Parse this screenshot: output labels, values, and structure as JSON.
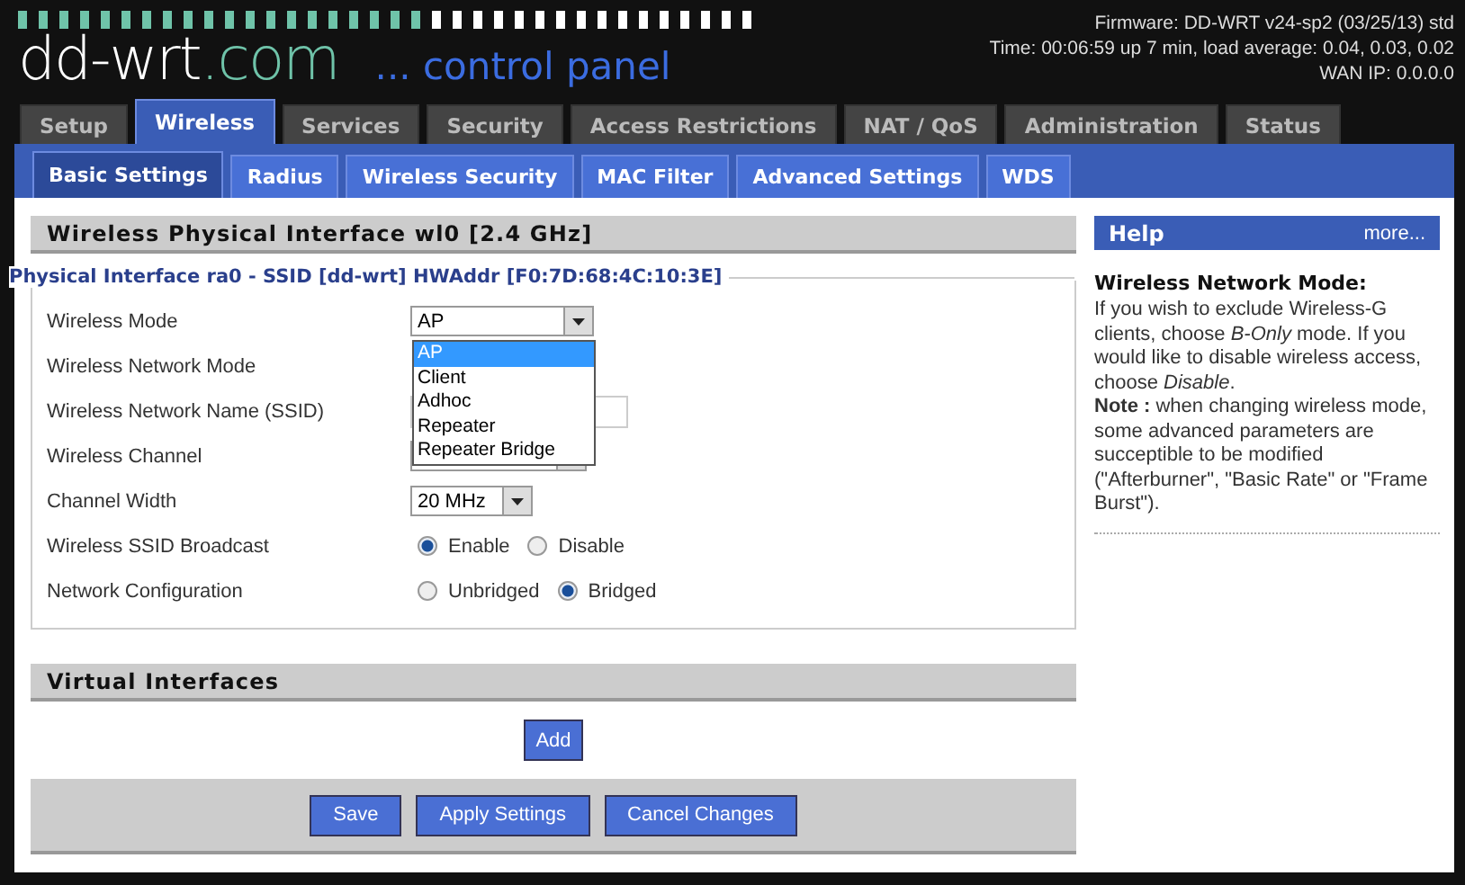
{
  "header": {
    "logo_main": "dd-wrt",
    "logo_suffix": ".com",
    "tagline": "... control panel",
    "info": [
      "Firmware: DD-WRT v24-sp2 (03/25/13) std",
      "Time: 00:06:59 up 7 min, load average: 0.04, 0.03, 0.02",
      "WAN IP: 0.0.0.0"
    ]
  },
  "tabs": [
    {
      "label": "Setup",
      "selected": false
    },
    {
      "label": "Wireless",
      "selected": true
    },
    {
      "label": "Services",
      "selected": false
    },
    {
      "label": "Security",
      "selected": false
    },
    {
      "label": "Access Restrictions",
      "selected": false
    },
    {
      "label": "NAT / QoS",
      "selected": false
    },
    {
      "label": "Administration",
      "selected": false
    },
    {
      "label": "Status",
      "selected": false
    }
  ],
  "subtabs": [
    {
      "label": "Basic Settings",
      "selected": true
    },
    {
      "label": "Radius",
      "selected": false
    },
    {
      "label": "Wireless Security",
      "selected": false
    },
    {
      "label": "MAC Filter",
      "selected": false
    },
    {
      "label": "Advanced Settings",
      "selected": false
    },
    {
      "label": "WDS",
      "selected": false
    }
  ],
  "section_title": "Wireless Physical Interface wl0 [2.4 GHz]",
  "fieldset_legend": "Physical Interface ra0 - SSID [dd-wrt] HWAddr [F0:7D:68:4C:10:3E]",
  "settings": [
    {
      "kind": "select",
      "label": "Wireless Mode",
      "value": "AP",
      "dropdown": {
        "options": [
          {
            "label": "AP",
            "selected": true
          },
          {
            "label": "Client",
            "selected": false
          },
          {
            "label": "Adhoc",
            "selected": false
          },
          {
            "label": "Repeater",
            "selected": false
          },
          {
            "label": "Repeater Bridge",
            "selected": false
          }
        ]
      }
    },
    {
      "kind": "hidden",
      "label": "Wireless Network Mode"
    },
    {
      "kind": "text",
      "label": "Wireless Network Name (SSID)"
    },
    {
      "kind": "hidden_select",
      "label": "Wireless Channel"
    },
    {
      "kind": "select",
      "label": "Channel Width",
      "value": "20 MHz"
    },
    {
      "kind": "radio",
      "label": "Wireless SSID Broadcast",
      "options": [
        {
          "label": "Enable",
          "selected": true
        },
        {
          "label": "Disable",
          "selected": false
        }
      ]
    },
    {
      "kind": "radio",
      "label": "Network Configuration",
      "options": [
        {
          "label": "Unbridged",
          "selected": false
        },
        {
          "label": "Bridged",
          "selected": true
        }
      ]
    }
  ],
  "virtual_title": "Virtual Interfaces",
  "add_button": "Add",
  "buttons": [
    "Save",
    "Apply Settings",
    "Cancel Changes"
  ],
  "help": {
    "title": "Help",
    "more": "more...",
    "heading": "Wireless Network Mode:",
    "text": "If you wish to exclude Wireless-G clients, choose *B-Only* mode. If you would like to disable wireless access, choose *Disable*.",
    "note": "**Note :** when changing wireless mode, some advanced parameters are succeptible to be modified (\"Afterburner\", \"Basic Rate\" or \"Frame Burst\")."
  }
}
